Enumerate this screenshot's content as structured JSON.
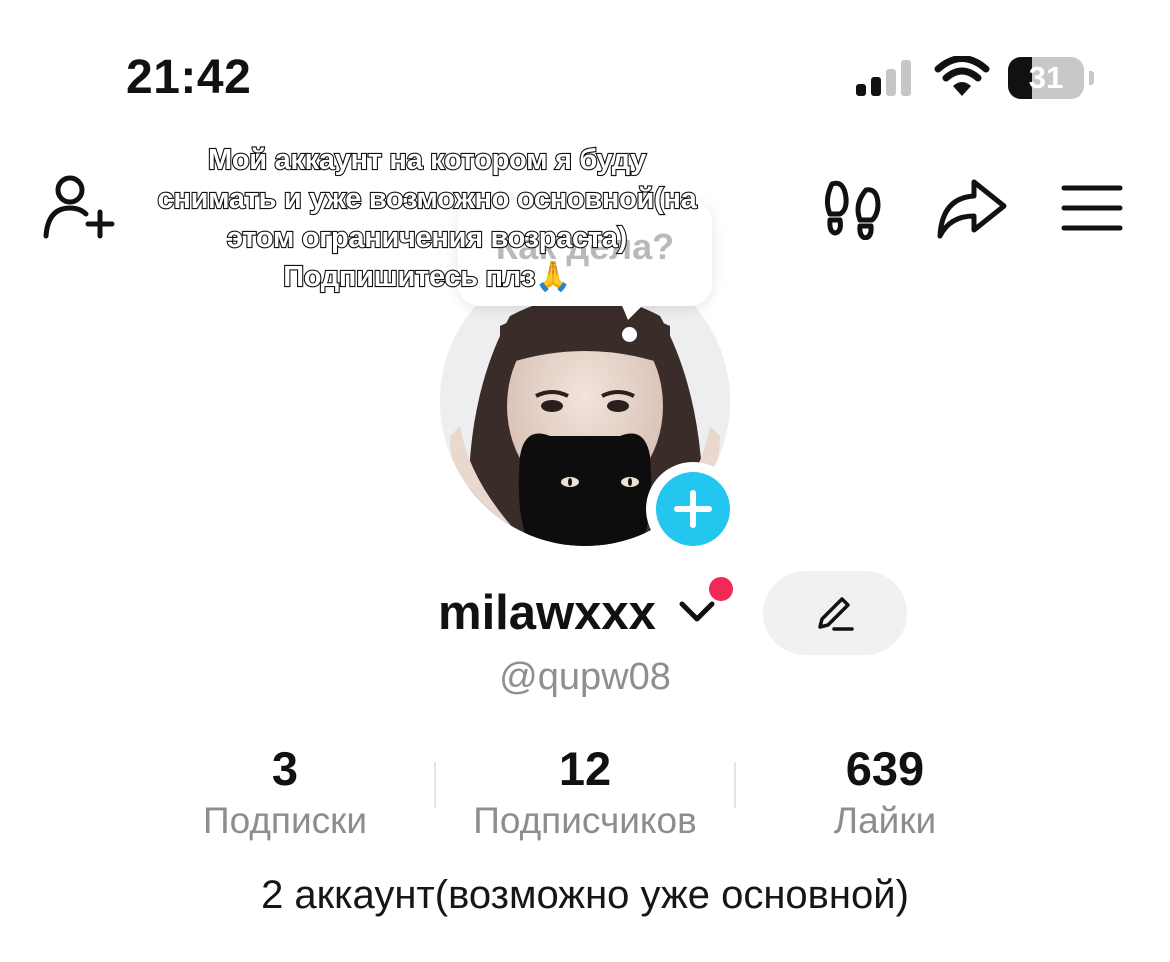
{
  "status_bar": {
    "time": "21:42",
    "battery_level": "31"
  },
  "top_bar": {
    "icons": [
      "add-friend-icon",
      "footprints-icon",
      "share-icon",
      "menu-icon"
    ]
  },
  "bubble": {
    "text": "Как дела?"
  },
  "overlay": {
    "lines": [
      "Мой аккаунт на котором я буду",
      "снимать и уже возможно основной(на",
      "этом ограничения возраста)",
      "Подпишитесь плз🙏"
    ]
  },
  "profile": {
    "username": "milawxxx",
    "handle": "@qupw08",
    "bio": "2 аккаунт(возможно уже основной)"
  },
  "stats": [
    {
      "value": "3",
      "label": "Подписки"
    },
    {
      "value": "12",
      "label": "Подписчиков"
    },
    {
      "value": "639",
      "label": "Лайки"
    }
  ],
  "colors": {
    "accent_add": "#22c6ee",
    "notification_dot": "#f02a54",
    "secondary_text": "#8f8f8f"
  }
}
